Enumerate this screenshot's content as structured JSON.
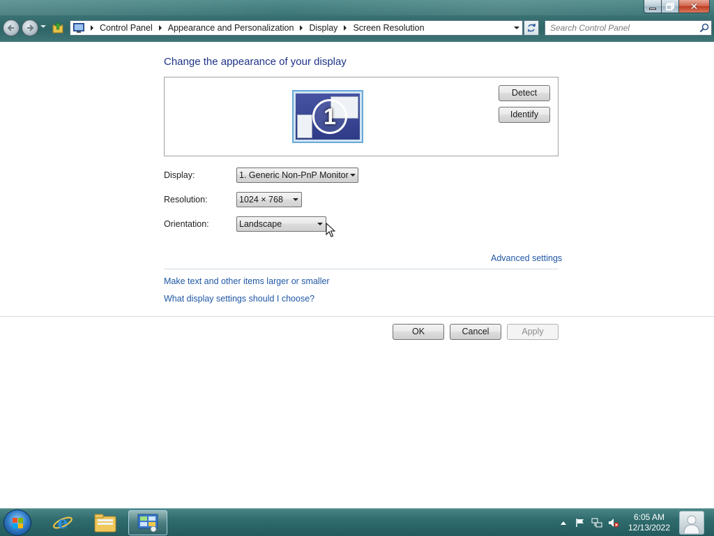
{
  "window": {
    "controls": {
      "minimize": "minimize",
      "maximize": "maximize",
      "close": "close"
    }
  },
  "nav": {
    "back": "back-arrow-icon",
    "forward": "forward-arrow-icon"
  },
  "address": {
    "breadcrumbs": [
      "Control Panel",
      "Appearance and Personalization",
      "Display",
      "Screen Resolution"
    ]
  },
  "search": {
    "placeholder": "Search Control Panel"
  },
  "page": {
    "title": "Change the appearance of your display",
    "detect_label": "Detect",
    "identify_label": "Identify",
    "monitor_number": "1",
    "display_label": "Display:",
    "display_value": "1. Generic Non-PnP Monitor",
    "resolution_label": "Resolution:",
    "resolution_value": "1024 × 768",
    "orientation_label": "Orientation:",
    "orientation_value": "Landscape",
    "advanced_link": "Advanced settings",
    "text_size_link": "Make text and other items larger or smaller",
    "help_link": "What display settings should I choose?",
    "ok_label": "OK",
    "cancel_label": "Cancel",
    "apply_label": "Apply"
  },
  "taskbar": {
    "items": [
      "start-orb",
      "internet-explorer-icon",
      "windows-explorer-icon",
      "control-panel-icon"
    ],
    "time": "6:05 AM",
    "date": "12/13/2022"
  },
  "colors": {
    "heading": "#1e3287",
    "link": "#1f57a5",
    "chrome": "#2f6567"
  }
}
